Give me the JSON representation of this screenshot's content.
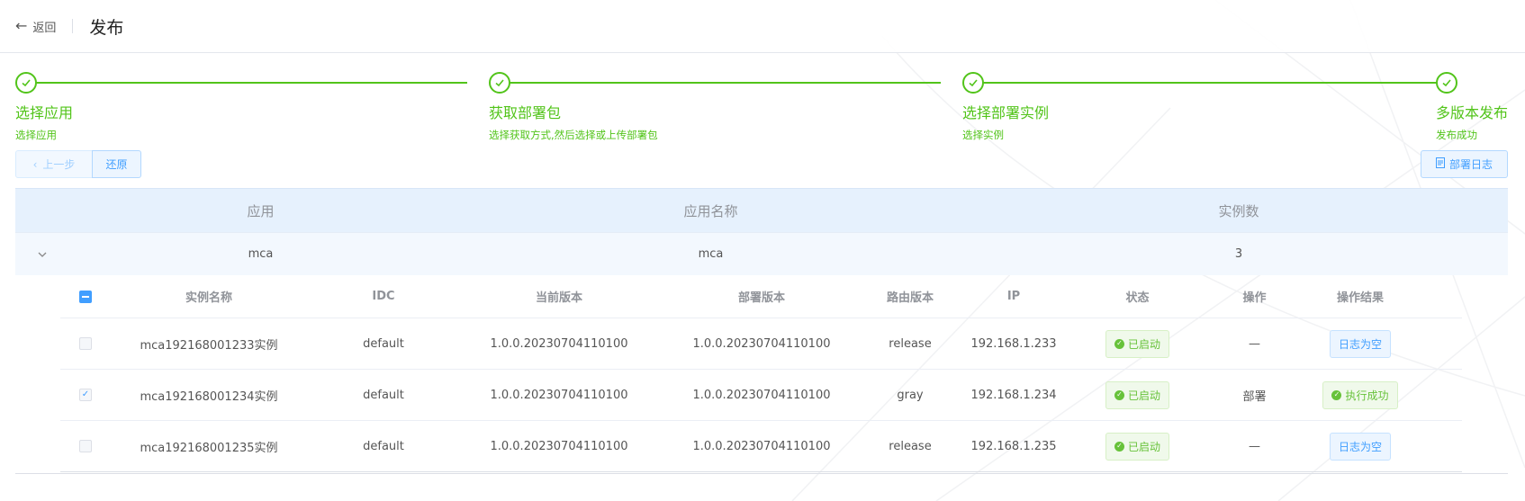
{
  "header": {
    "back_label": "返回",
    "title": "发布"
  },
  "steps": [
    {
      "title": "选择应用",
      "desc": "选择应用"
    },
    {
      "title": "获取部署包",
      "desc": "选择获取方式,然后选择或上传部署包"
    },
    {
      "title": "选择部署实例",
      "desc": "选择实例"
    },
    {
      "title": "多版本发布",
      "desc": "发布成功"
    }
  ],
  "toolbar": {
    "prev_label": "上一步",
    "restore_label": "还原",
    "log_label": "部署日志"
  },
  "outer_table": {
    "columns": [
      "应用",
      "应用名称",
      "实例数"
    ],
    "row": {
      "app": "mca",
      "app_name": "mca",
      "instances": "3"
    }
  },
  "inner_table": {
    "columns": [
      "实例名称",
      "IDC",
      "当前版本",
      "部署版本",
      "路由版本",
      "IP",
      "状态",
      "操作",
      "操作结果"
    ],
    "rows": [
      {
        "checked": false,
        "name": "mca192168001233实例",
        "idc": "default",
        "current": "1.0.0.20230704110100",
        "deploy": "1.0.0.20230704110100",
        "route": "release",
        "ip": "192.168.1.233",
        "status": "已启动",
        "op": "—",
        "result": "日志为空",
        "result_type": "info"
      },
      {
        "checked": true,
        "name": "mca192168001234实例",
        "idc": "default",
        "current": "1.0.0.20230704110100",
        "deploy": "1.0.0.20230704110100",
        "route": "gray",
        "ip": "192.168.1.234",
        "status": "已启动",
        "op": "部署",
        "result": "执行成功",
        "result_type": "success"
      },
      {
        "checked": false,
        "name": "mca192168001235实例",
        "idc": "default",
        "current": "1.0.0.20230704110100",
        "deploy": "1.0.0.20230704110100",
        "route": "release",
        "ip": "192.168.1.235",
        "status": "已启动",
        "op": "—",
        "result": "日志为空",
        "result_type": "info"
      }
    ]
  },
  "colors": {
    "success": "#52c41a",
    "primary": "#409eff",
    "header_bg": "#e6f1fd"
  }
}
